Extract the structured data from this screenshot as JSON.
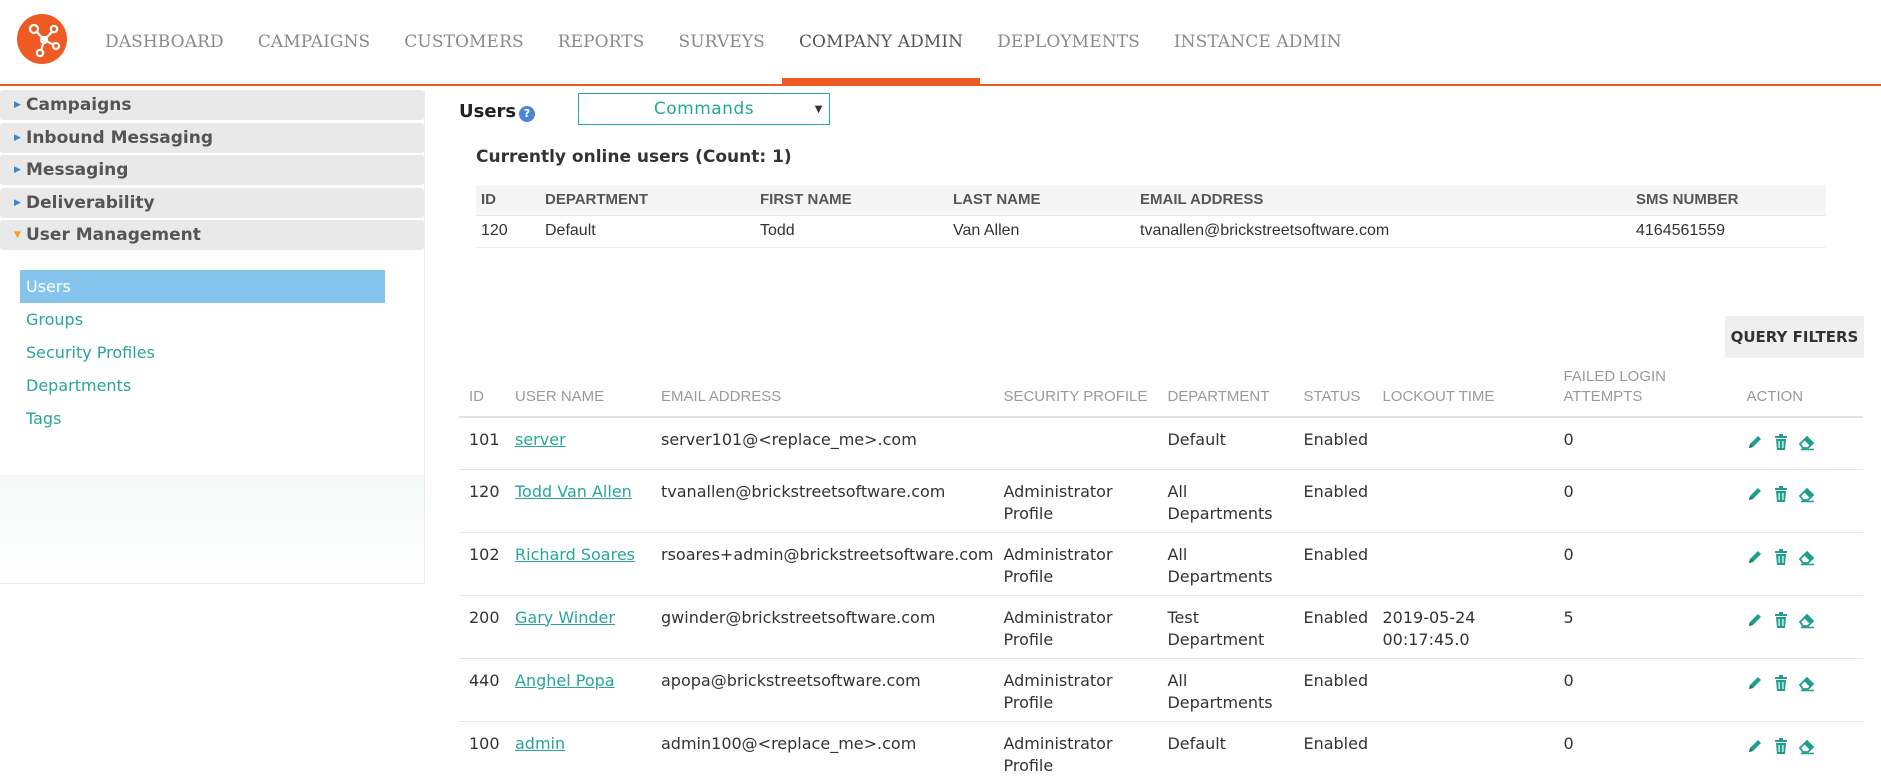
{
  "nav": {
    "items": [
      "DASHBOARD",
      "CAMPAIGNS",
      "CUSTOMERS",
      "REPORTS",
      "SURVEYS",
      "COMPANY ADMIN",
      "DEPLOYMENTS",
      "INSTANCE ADMIN"
    ],
    "active": "COMPANY ADMIN"
  },
  "sidebar": {
    "sections": [
      "Campaigns",
      "Inbound Messaging",
      "Messaging",
      "Deliverability",
      "User Management"
    ],
    "open_section": "User Management",
    "links": [
      "Users",
      "Groups",
      "Security Profiles",
      "Departments",
      "Tags"
    ],
    "active_link": "Users"
  },
  "page": {
    "title": "Users",
    "help_icon": "?",
    "commands_label": "Commands"
  },
  "online": {
    "title": "Currently online users (Count: 1)",
    "columns": [
      "ID",
      "DEPARTMENT",
      "FIRST NAME",
      "LAST NAME",
      "EMAIL ADDRESS",
      "SMS NUMBER"
    ],
    "rows": [
      [
        "120",
        "Default",
        "Todd",
        "Van Allen",
        "tvanallen@brickstreetsoftware.com",
        "4164561559"
      ]
    ]
  },
  "query_filters_label": "QUERY FILTERS",
  "users": {
    "columns": [
      "ID",
      "USER NAME",
      "EMAIL ADDRESS",
      "SECURITY PROFILE",
      "DEPARTMENT",
      "STATUS",
      "LOCKOUT TIME",
      "FAILED LOGIN ATTEMPTS",
      "ACTION"
    ],
    "rows": [
      {
        "id": "101",
        "username": "server",
        "email": "server101@<replace_me>.com",
        "profile": "",
        "department": "Default",
        "status": "Enabled",
        "lockout": "",
        "failed": "0"
      },
      {
        "id": "120",
        "username": "Todd Van Allen",
        "email": "tvanallen@brickstreetsoftware.com",
        "profile": "Administrator Profile",
        "department": "All Departments",
        "status": "Enabled",
        "lockout": "",
        "failed": "0"
      },
      {
        "id": "102",
        "username": "Richard Soares",
        "email": "rsoares+admin@brickstreetsoftware.com",
        "profile": "Administrator Profile",
        "department": "All Departments",
        "status": "Enabled",
        "lockout": "",
        "failed": "0"
      },
      {
        "id": "200",
        "username": "Gary Winder",
        "email": "gwinder@brickstreetsoftware.com",
        "profile": "Administrator Profile",
        "department": "Test Department",
        "status": "Enabled",
        "lockout": "2019-05-24 00:17:45.0",
        "failed": "5"
      },
      {
        "id": "440",
        "username": "Anghel Popa",
        "email": "apopa@brickstreetsoftware.com",
        "profile": "Administrator Profile",
        "department": "All Departments",
        "status": "Enabled",
        "lockout": "",
        "failed": "0"
      },
      {
        "id": "100",
        "username": "admin",
        "email": "admin100@<replace_me>.com",
        "profile": "Administrator Profile",
        "department": "Default",
        "status": "Enabled",
        "lockout": "",
        "failed": "0"
      }
    ],
    "action_icons": [
      "pencil-icon",
      "trash-icon",
      "eraser-icon"
    ]
  },
  "colors": {
    "brand": "#ef5a24",
    "link": "#27a69a",
    "active_sidebar": "#85c4ec"
  }
}
